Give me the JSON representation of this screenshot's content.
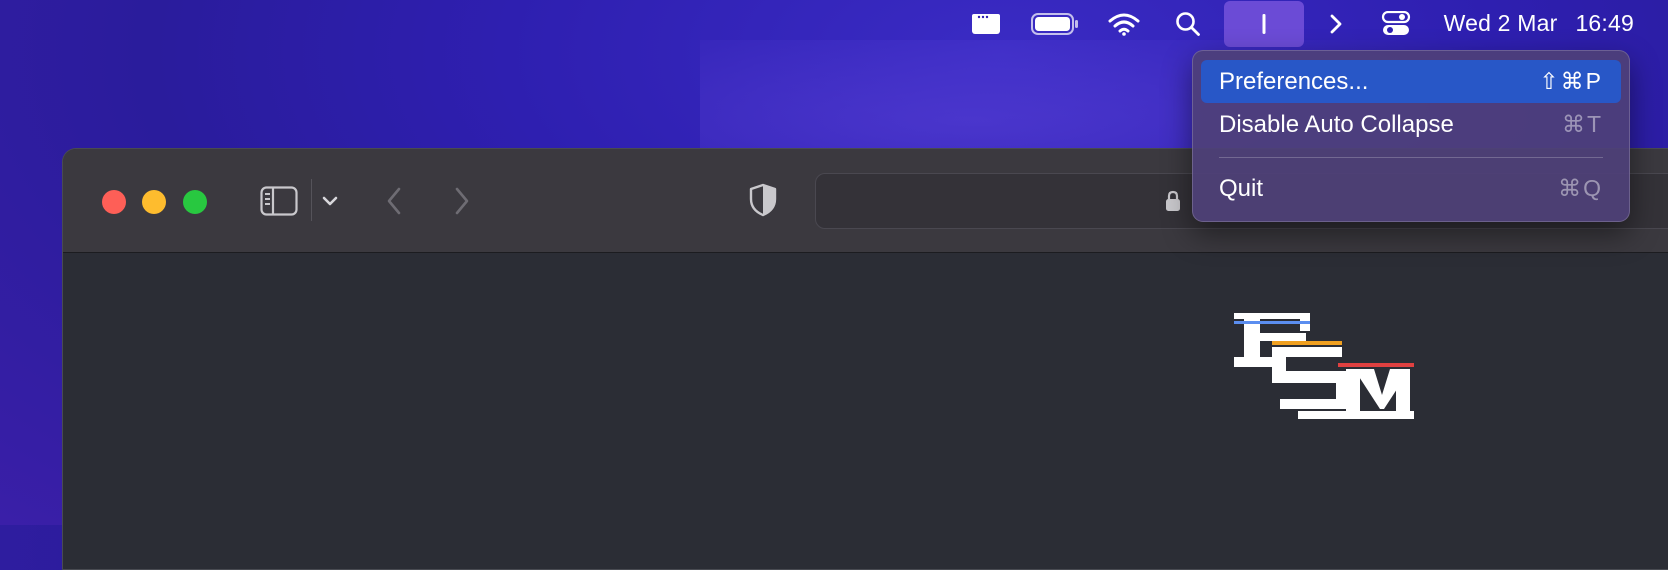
{
  "menubar": {
    "icons": [
      "app-window-icon",
      "battery-icon",
      "wifi-icon",
      "spotlight-search-icon",
      "menu-extra-icon",
      "chevron-right-icon",
      "control-center-icon"
    ],
    "date": "Wed 2 Mar",
    "time": "16:49",
    "active_accent": "#6b4bd6"
  },
  "menu": {
    "items": [
      {
        "label": "Preferences...",
        "shortcut": "⇧⌘P",
        "highlighted": true
      },
      {
        "label": "Disable Auto Collapse",
        "shortcut": "⌘T",
        "highlighted": false
      },
      {
        "label": "Quit",
        "shortcut": "⌘Q",
        "highlighted": false
      }
    ],
    "highlight_color": "#2857c7"
  },
  "browser": {
    "traffic_lights": [
      "#fe5f57",
      "#febc2e",
      "#28c840"
    ],
    "toolbar_icons": [
      "sidebar-icon",
      "chevron-down-icon",
      "back-arrow-icon",
      "forward-arrow-icon",
      "privacy-shield-icon",
      "lock-icon"
    ],
    "logo": {
      "letters": "FSM",
      "stripe_colors": [
        "#f0a020",
        "#5b8ef0",
        "#e04040"
      ]
    }
  }
}
